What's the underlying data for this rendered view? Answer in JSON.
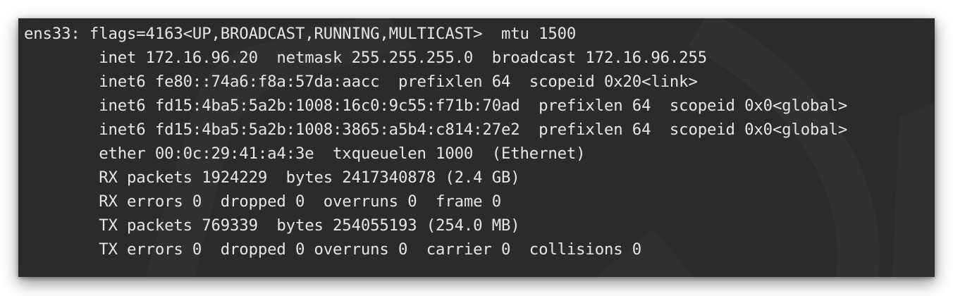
{
  "terminal": {
    "lines": [
      "ens33: flags=4163<UP,BROADCAST,RUNNING,MULTICAST>  mtu 1500",
      "        inet 172.16.96.20  netmask 255.255.255.0  broadcast 172.16.96.255",
      "        inet6 fe80::74a6:f8a:57da:aacc  prefixlen 64  scopeid 0x20<link>",
      "        inet6 fd15:4ba5:5a2b:1008:16c0:9c55:f71b:70ad  prefixlen 64  scopeid 0x0<global>",
      "        inet6 fd15:4ba5:5a2b:1008:3865:a5b4:c814:27e2  prefixlen 64  scopeid 0x0<global>",
      "        ether 00:0c:29:41:a4:3e  txqueuelen 1000  (Ethernet)",
      "        RX packets 1924229  bytes 2417340878 (2.4 GB)",
      "        RX errors 0  dropped 0  overruns 0  frame 0",
      "        TX packets 769339  bytes 254055193 (254.0 MB)",
      "        TX errors 0  dropped 0 overruns 0  carrier 0  collisions 0"
    ]
  },
  "colors": {
    "background": "#2b2b2b",
    "text": "#e6e6e6",
    "watermark": "#333333"
  }
}
